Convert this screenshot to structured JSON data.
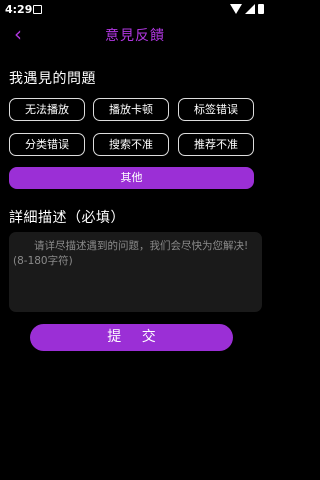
{
  "status_bar": {
    "time": "4:29"
  },
  "header": {
    "back_icon": "‹",
    "title": "意見反饋"
  },
  "problems": {
    "title": "我遇見的問題",
    "tags": [
      "无法播放",
      "播放卡顿",
      "标签错误",
      "分类错误",
      "搜索不准",
      "推荐不准"
    ],
    "other": "其他"
  },
  "description": {
    "title": "詳細描述（必填）",
    "placeholder_line1": "请详尽描述遇到的问题，我们会尽快为您解决!",
    "placeholder_line2": "(8-180字符)"
  },
  "submit_label": "提 交",
  "colors": {
    "accent": "#9b2fd6",
    "background": "#000000"
  }
}
